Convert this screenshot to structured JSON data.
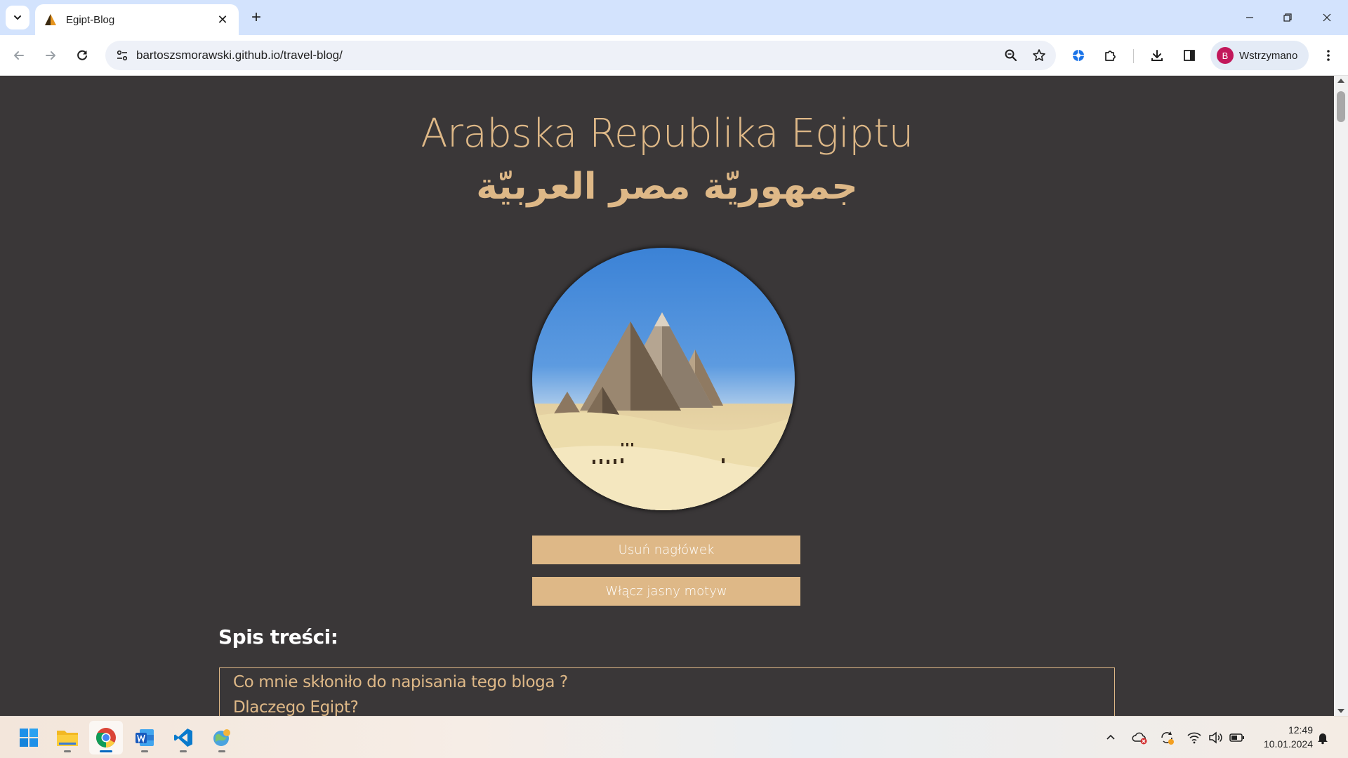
{
  "browser": {
    "tab_title": "Egipt-Blog",
    "url": "bartoszsmorawski.github.io/travel-blog/",
    "profile_initial": "B",
    "profile_name": "Wstrzymano"
  },
  "page": {
    "title": "Arabska Republika Egiptu",
    "title_arabic": "جمهوريّة مصر العربيّة",
    "buttons": {
      "remove_header": "Usuń nagłówek",
      "light_theme": "Włącz jasny motyw"
    },
    "toc": {
      "heading": "Spis treści:",
      "items": [
        "Co mnie skłoniło do napisania tego bloga ?",
        "Dlaczego Egipt?"
      ]
    }
  },
  "taskbar": {
    "time": "12:49",
    "date": "10.01.2024"
  },
  "colors": {
    "accent": "#deb887",
    "page_background": "#3a3738",
    "browser_frame": "#d3e3fd"
  }
}
